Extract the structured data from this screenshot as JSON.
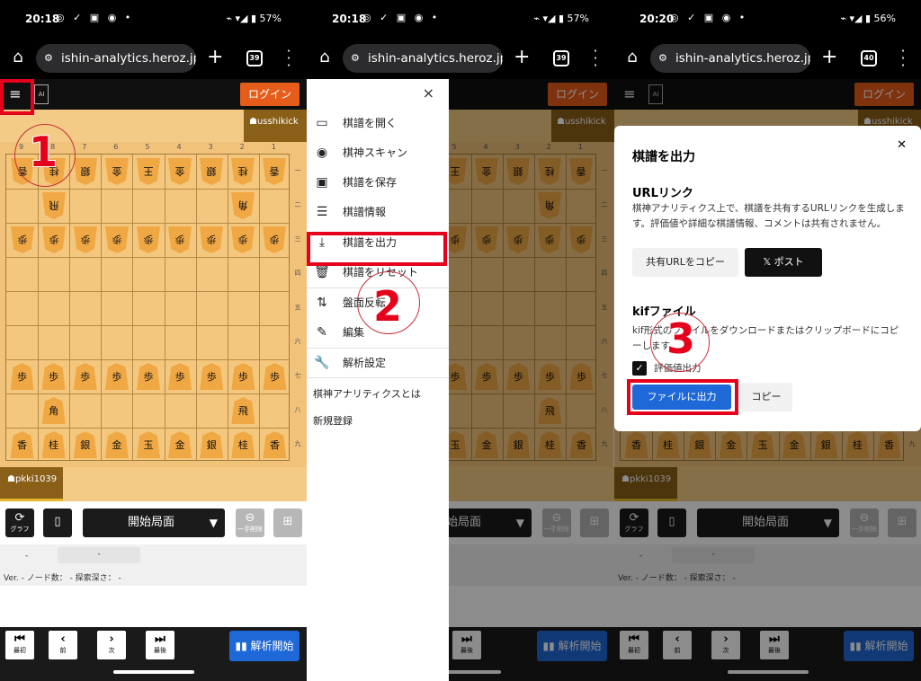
{
  "status_bars": [
    {
      "time": "20:18",
      "battery": "57%"
    },
    {
      "time": "20:18",
      "battery": "57%"
    },
    {
      "time": "20:20",
      "battery": "56%"
    }
  ],
  "browser": {
    "url": "ishin-analytics.heroz.jp",
    "tab_counts": [
      "39",
      "39",
      "40"
    ]
  },
  "app": {
    "login_label": "ログイン",
    "logo_label": "AI"
  },
  "board": {
    "columns": [
      "9",
      "8",
      "7",
      "6",
      "5",
      "4",
      "3",
      "2",
      "1"
    ],
    "rows": [
      "一",
      "二",
      "三",
      "四",
      "五",
      "六",
      "七",
      "八",
      "九"
    ],
    "gote_player": "usshikick",
    "sente_player": "pkki1039",
    "gote_row1": [
      "香",
      "桂",
      "銀",
      "金",
      "王",
      "金",
      "銀",
      "桂",
      "香"
    ],
    "gote_rook": "飛",
    "gote_bishop": "角",
    "pawn": "歩",
    "sente_row9": [
      "香",
      "桂",
      "銀",
      "金",
      "玉",
      "金",
      "銀",
      "桂",
      "香"
    ],
    "sente_bishop": "角",
    "sente_rook": "飛"
  },
  "controls": {
    "graph_label": "グラフ",
    "position_select": "開始局面",
    "undo_label": "一手削除",
    "version_text": "-",
    "eval_text": "-",
    "meta_text": "Ver. - ノード数： - 探索深さ： -"
  },
  "nav": {
    "first": "最初",
    "prev": "前",
    "next": "次",
    "last": "最後",
    "analyze": "解析開始"
  },
  "menu": {
    "items": [
      "棋譜を開く",
      "棋神スキャン",
      "棋譜を保存",
      "棋譜情報",
      "棋譜を出力",
      "棋譜をリセット",
      "盤面反転",
      "編集",
      "解析設定"
    ],
    "about": "棋神アナリティクスとは",
    "register": "新規登録"
  },
  "dialog": {
    "title": "棋譜を出力",
    "url_heading": "URLリンク",
    "url_desc": "棋神アナリティクス上で、棋譜を共有するURLリンクを生成します。評価値や詳細な棋譜情報、コメントは共有されません。",
    "copy_url": "共有URLをコピー",
    "post": "ポスト",
    "kif_heading": "kifファイル",
    "kif_desc": "kif形式のファイルをダウンロードまたはクリップボードにコピーします。",
    "eval_checkbox": "評価値出力",
    "export_file": "ファイルに出力",
    "copy": "コピー"
  },
  "steps": [
    "1",
    "2",
    "3"
  ],
  "accent_colors": {
    "highlight": "#e5001b",
    "login": "#e65c1a",
    "primary": "#1e68d8"
  }
}
